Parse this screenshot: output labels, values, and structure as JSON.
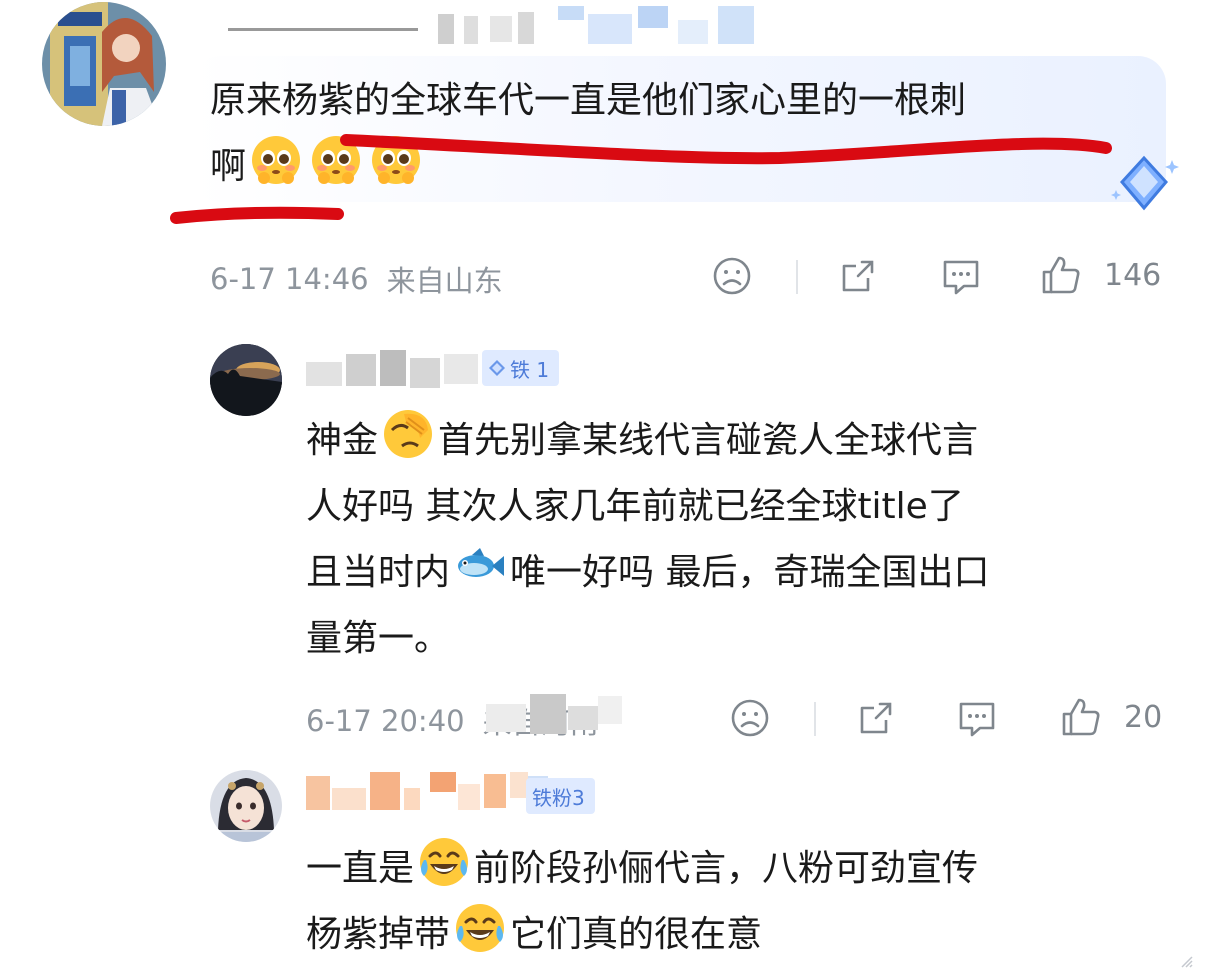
{
  "comments": [
    {
      "text": "原来杨紫的全球车代一直是他们家心里的一根刺",
      "text2": "啊",
      "meta": {
        "date": "6-17 14:46",
        "location": "来自山东"
      },
      "likes": "146"
    },
    {
      "badge": "铁 1",
      "line1_a": "神金",
      "line1_b": "首先别拿某线代言碰瓷人全球代言",
      "line2": "人好吗 其次人家几年前就已经全球title了",
      "line3_a": "且当时内",
      "line3_b": "唯一好吗 最后，奇瑞全国出口",
      "line4": "量第一。",
      "meta": {
        "date": "6-17 20:40",
        "location": "来自河南"
      },
      "likes": "20"
    },
    {
      "badge": "铁粉3",
      "line1_a": "一直是",
      "line1_b": "前阶段孙俪代言，八粉可劲宣传",
      "line2_a": "杨紫掉带",
      "line2_b": "它们真的很在意"
    }
  ],
  "icons": {
    "dislike": "sad-face-icon",
    "share": "share-icon",
    "reply": "comment-icon",
    "like": "thumbs-up-icon"
  },
  "colors": {
    "annotation": "#d90a12",
    "meta": "#8e959d",
    "badge_bg": "#dfeaff",
    "badge_text": "#4d7bd8"
  }
}
